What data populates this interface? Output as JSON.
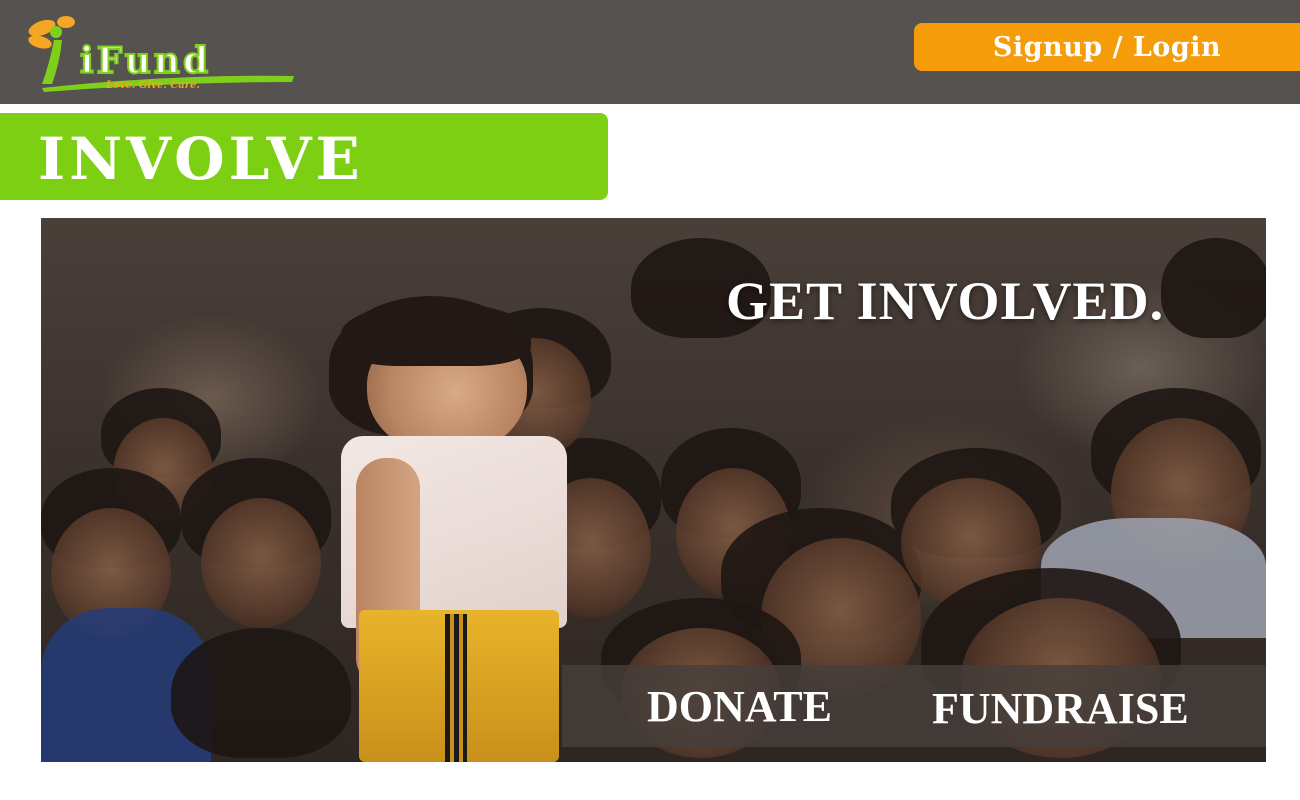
{
  "header": {
    "logo_text": "iFund",
    "logo_tagline": "Love. Give. Care.",
    "signup_login_label": "Signup / Login"
  },
  "banner": {
    "title": "INVOLVE"
  },
  "hero": {
    "headline": "GET INVOLVED.",
    "donate_label": "DONATE",
    "fundraise_label": "FUNDRAISE"
  },
  "colors": {
    "header_bg": "#565250",
    "accent_orange": "#f59c0a",
    "accent_green": "#7dcf14"
  }
}
